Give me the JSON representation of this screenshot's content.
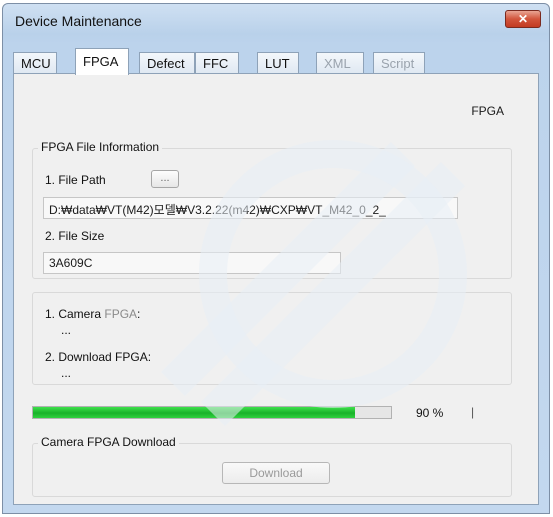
{
  "window": {
    "title": "Device Maintenance",
    "close_glyph": "✕"
  },
  "tabs": [
    {
      "label": "MCU",
      "state": "normal"
    },
    {
      "label": "FPGA",
      "state": "active"
    },
    {
      "label": "Defect",
      "state": "normal"
    },
    {
      "label": "FFC",
      "state": "normal"
    },
    {
      "label": "LUT",
      "state": "normal"
    },
    {
      "label": "XML",
      "state": "disabled"
    },
    {
      "label": "Script",
      "state": "disabled"
    }
  ],
  "panel": {
    "corner_label": "FPGA",
    "file_info": {
      "title": "FPGA File Information",
      "file_path_label": "1. File Path",
      "browse_label": "...",
      "file_path_value": "D:₩data₩VT(M42)모델₩V3.2.22(m42)₩CXP₩VT_M42_0_2_",
      "file_size_label": "2. File Size",
      "file_size_value": "3A609C"
    },
    "versions": {
      "camera_label_prefix": "1. Camera",
      "camera_label_emph": "FPGA",
      "camera_label_suffix": ":",
      "camera_value": "...",
      "download_label": "2. Download FPGA:",
      "download_value": "..."
    },
    "progress": {
      "percent": 90,
      "text": "90 %",
      "marker": "|"
    },
    "download": {
      "title": "Camera FPGA Download",
      "button_label": "Download"
    }
  },
  "colors": {
    "progress": "#19b22a",
    "accent": "#d2553c"
  }
}
